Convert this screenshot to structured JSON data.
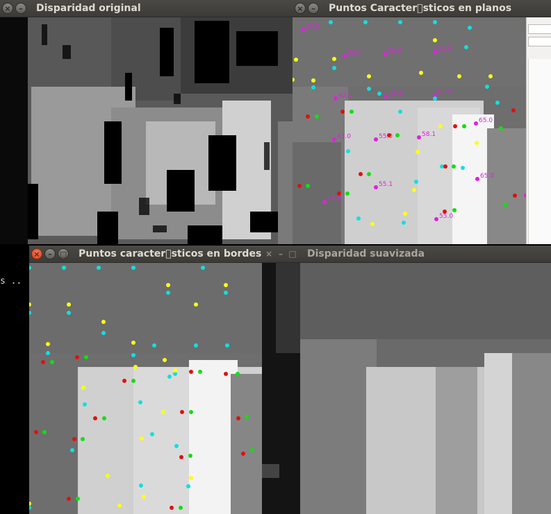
{
  "windows": {
    "original": {
      "title": "Disparidad original",
      "close": "×",
      "minimize": "–"
    },
    "planes": {
      "title": "Puntos Caracter￿sticos en planos",
      "close": "×",
      "minimize": "–"
    },
    "edges": {
      "title": "Puntos caracter￿sticos en bordes",
      "close": "×",
      "minimize": "–",
      "maximize": "□"
    },
    "smoothed": {
      "title": "Disparidad suavizada",
      "close": "×",
      "minimize": "–",
      "maximize": "□"
    }
  },
  "terminal": {
    "text": "s .."
  },
  "plane_labels": [
    "52.0",
    "50.7",
    "50.0",
    "51.0",
    "42.0",
    "40.0",
    "51.3",
    "65.0",
    "43.0",
    "55.0",
    "58.1",
    "65.0",
    "55.1",
    "44.0",
    "55.0",
    "4"
  ],
  "colors": {
    "magenta": "#e020e0",
    "cyan": "#10e0e0",
    "yellow": "#ffff10",
    "red": "#e01010",
    "green": "#10e010",
    "titlebar": "#3c3b37",
    "title_text": "#dfdbd2"
  }
}
